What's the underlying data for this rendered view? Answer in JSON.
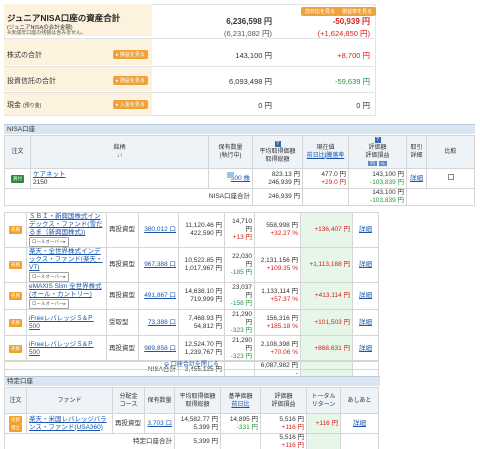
{
  "summary": {
    "title": "ジュニアNISA口座の資産合計",
    "sub1": "(ジュニアNISAの合計金額)",
    "sub2": "※未成年口座の残額は含みません。",
    "btn_prev": "前日比を見る",
    "btn_yield": "損益率を見る",
    "total_value": "6,236,598 円",
    "total_change": "-50,939 円",
    "total_cost": "(6,231,082 円)",
    "total_gain": "(+1,624,850 円)",
    "stock_label": "株式の合計",
    "stock_btn": "▸ 損益を見る",
    "stock_value": "143,100 円",
    "stock_change": "+8,700 円",
    "fund_label": "投資信託の合計",
    "fund_btn": "▸ 損益を見る",
    "fund_value": "6,093,498 円",
    "fund_change": "-59,639 円",
    "cash_label": "現金",
    "cash_sub": "(預り金)",
    "cash_btn": "▸ 入金を見る",
    "cash_value": "0 円",
    "cash_change": "0 円"
  },
  "nisa_stock": {
    "header": "NISA口座",
    "cols": {
      "order": "注文",
      "name": "銘柄",
      "sort": "↓↑",
      "qty": "保有数量",
      "qty_sub": "(執行中)",
      "avg": "平均取得価額",
      "cost": "取得総額",
      "cur": "現在値",
      "cur_sub1": "前日比",
      "cur_sub2": "騰落率",
      "pl": "評価額",
      "pl2": "評価損益",
      "pl_btn1": "円",
      "pl_btn2": "%",
      "trade": "取引",
      "detail": "詳細",
      "compare": "比較"
    },
    "row": {
      "order": "買付",
      "name": "ケアネット",
      "code": "2150",
      "qty": "300 株",
      "avg": "823.13 円",
      "cost": "246,939 円",
      "cur": "477.0 円",
      "chg": "+29.0 円",
      "val": "143,100 円",
      "pl": "-103,839 円"
    },
    "total_label": "NISA口座合計",
    "total_cost": "246,939 円",
    "total_val": "143,100 円",
    "total_pl": "-103,839 円"
  },
  "nisa_fund": {
    "rows": [
      {
        "tag": "売買",
        "name": "ＳＢＩ・新興国株式インデックス・ファンド(雪だるま（新興国株式))",
        "roll": "ロールオーバー▸",
        "type": "再投資型",
        "qty": "380,012 口",
        "avg": "11,120.46 円",
        "cost": "422,590 円",
        "cur": "14,710 円",
        "chg": "+13 円",
        "val": "558,998 円",
        "pct": "+32.27 %",
        "pl": "+136,407 円",
        "detail": "詳細"
      },
      {
        "tag": "売買",
        "name": "楽天・全世界株式インデックス・ファンド(楽天・VT)",
        "roll": "ロールオーバー▸",
        "type": "再投資型",
        "qty": "967,388 口",
        "avg": "10,522.85 円",
        "cost": "1,017,967 円",
        "cur": "22,030 円",
        "chg": "-185 円",
        "val": "2,131,156 円",
        "pct": "+109.35 %",
        "pl": "+1,113,188 円",
        "detail": "詳細"
      },
      {
        "tag": "売買",
        "name": "eMAXIS Slim 全世界株式(オール・カントリー)",
        "roll": "ロールオーバー▸",
        "type": "再投資型",
        "qty": "491,867 口",
        "avg": "14,638.10 円",
        "cost": "719,999 円",
        "cur": "23,037 円",
        "chg": "-158 円",
        "val": "1,133,114 円",
        "pct": "+57.37 %",
        "pl": "+413,114 円",
        "detail": "詳細"
      },
      {
        "tag": "売買",
        "name": "iFreeレバレッジＳ&Ｐ500",
        "roll": "",
        "type": "受取型",
        "qty": "73,388 口",
        "avg": "7,468.93 円",
        "cost": "54,812 円",
        "cur": "21,290 円",
        "chg": "-323 円",
        "val": "156,316 円",
        "pct": "+185.18 %",
        "pl": "+101,503 円",
        "detail": "詳細"
      },
      {
        "tag": "売買",
        "name": "iFreeレバレッジＳ&Ｐ500",
        "roll": "",
        "type": "再投資型",
        "qty": "989,858 口",
        "avg": "12,524.70 円",
        "cost": "1,239,767 円",
        "cur": "21,290 円",
        "chg": "-323 円",
        "val": "2,108,398 円",
        "pct": "+70.06 %",
        "pl": "+868,631 円",
        "detail": "詳細"
      }
    ],
    "total_label": "NISA合計",
    "total_cost": "3,455,135 円",
    "total_val": "6,087,982 円",
    "total_pl": "-",
    "close_link": "⊖ 口座合計を閉じる"
  },
  "tokutei": {
    "header": "特定口座",
    "cols": {
      "order": "注文",
      "fund": "ファンド",
      "dist": "分配金",
      "dist2": "コース",
      "qty": "保有数量",
      "avg": "平均取得価額",
      "cost": "取得総額",
      "base": "基準価額",
      "base_sub": "前日比",
      "pl": "評価額",
      "pl2": "評価損益",
      "total": "トータル",
      "total2": "リターン",
      "memo": "あしあと"
    },
    "row": {
      "tag1": "売買",
      "tag2": "積立",
      "name": "楽天・米国レバレッジバランス・ファンド(USA360)",
      "type": "再投資型",
      "qty": "3,703 口",
      "avg": "14,582.77 円",
      "cost": "5,399 円",
      "base": "14,895 円",
      "chg": "-331 円",
      "val": "5,516 円",
      "pl": "+116 円",
      "ret": "+116 円",
      "detail": "詳細"
    },
    "total_label": "特定口座合計",
    "total_cost": "5,399 円",
    "total_val": "5,516 円",
    "total_pl": "+116 円"
  }
}
